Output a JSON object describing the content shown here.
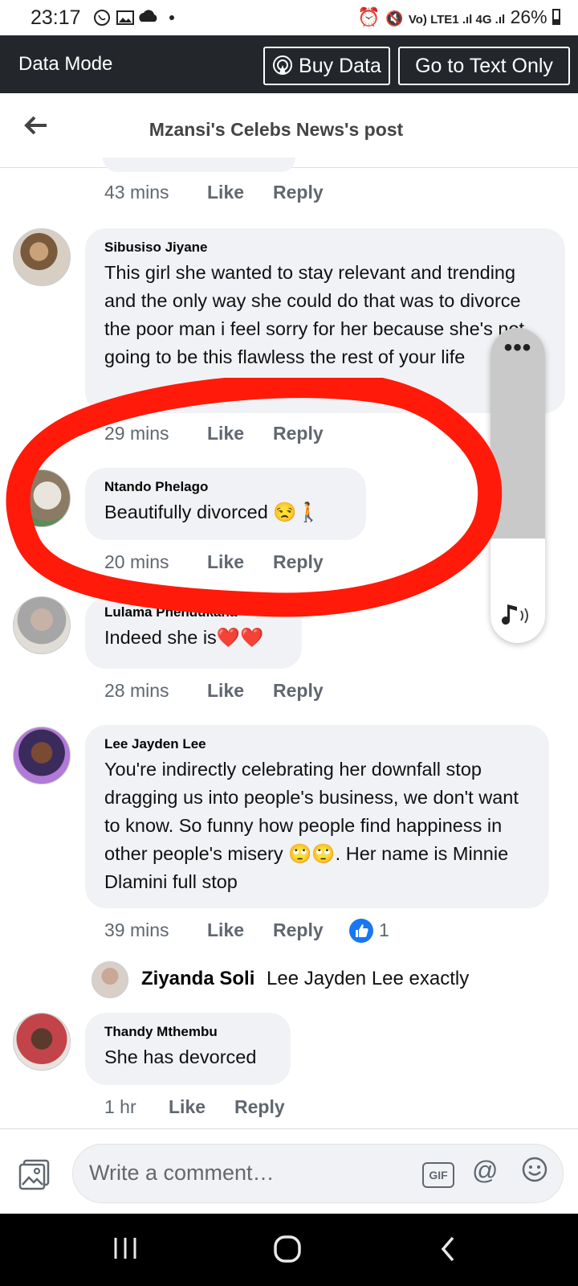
{
  "status_bar": {
    "time": "23:17",
    "net": "Vo) LTE1 .ıl 4G .ıl",
    "battery": "26%"
  },
  "data_bar": {
    "label": "Data Mode",
    "buy_data": "Buy Data",
    "text_only": "Go to Text Only"
  },
  "header": {
    "title": "Mzansi's Celebs News's post"
  },
  "prev_comment": {
    "time": "43 mins",
    "like": "Like",
    "reply": "Reply"
  },
  "comments": [
    {
      "name": "Sibusiso Jiyane",
      "text": "This girl she wanted to stay relevant and trending and the only way she could do that was to divorce the poor man i feel sorry for her because she's not going to be this flawless the rest of your life",
      "time": "29 mins",
      "like": "Like",
      "reply": "Reply"
    },
    {
      "name": "Ntando Phelago",
      "text": "Beautifully divorced 😒🚶",
      "time": "20 mins",
      "like": "Like",
      "reply": "Reply"
    },
    {
      "name": "Lulama Phendukana",
      "text": "Indeed she is❤️❤️",
      "time": "28 mins",
      "like": "Like",
      "reply": "Reply"
    },
    {
      "name": "Lee Jayden Lee",
      "text": "You're indirectly celebrating her downfall stop dragging us into people's business, we don't want to know. So funny how people find happiness in other people's misery 🙄🙄. Her name is Minnie Dlamini full stop",
      "time": "39 mins",
      "like": "Like",
      "reply": "Reply",
      "reactions": "1"
    },
    {
      "name": "Thandy Mthembu",
      "text": "She has devorced",
      "time": "1 hr",
      "like": "Like",
      "reply": "Reply"
    }
  ],
  "reply_preview": {
    "name": "Ziyanda Soli",
    "text": "Lee Jayden Lee exactly"
  },
  "composer": {
    "placeholder": "Write a comment…",
    "gif": "GIF",
    "at": "@"
  },
  "colors": {
    "annotation_red": "#ff1a0a",
    "like_blue": "#1877f2"
  }
}
